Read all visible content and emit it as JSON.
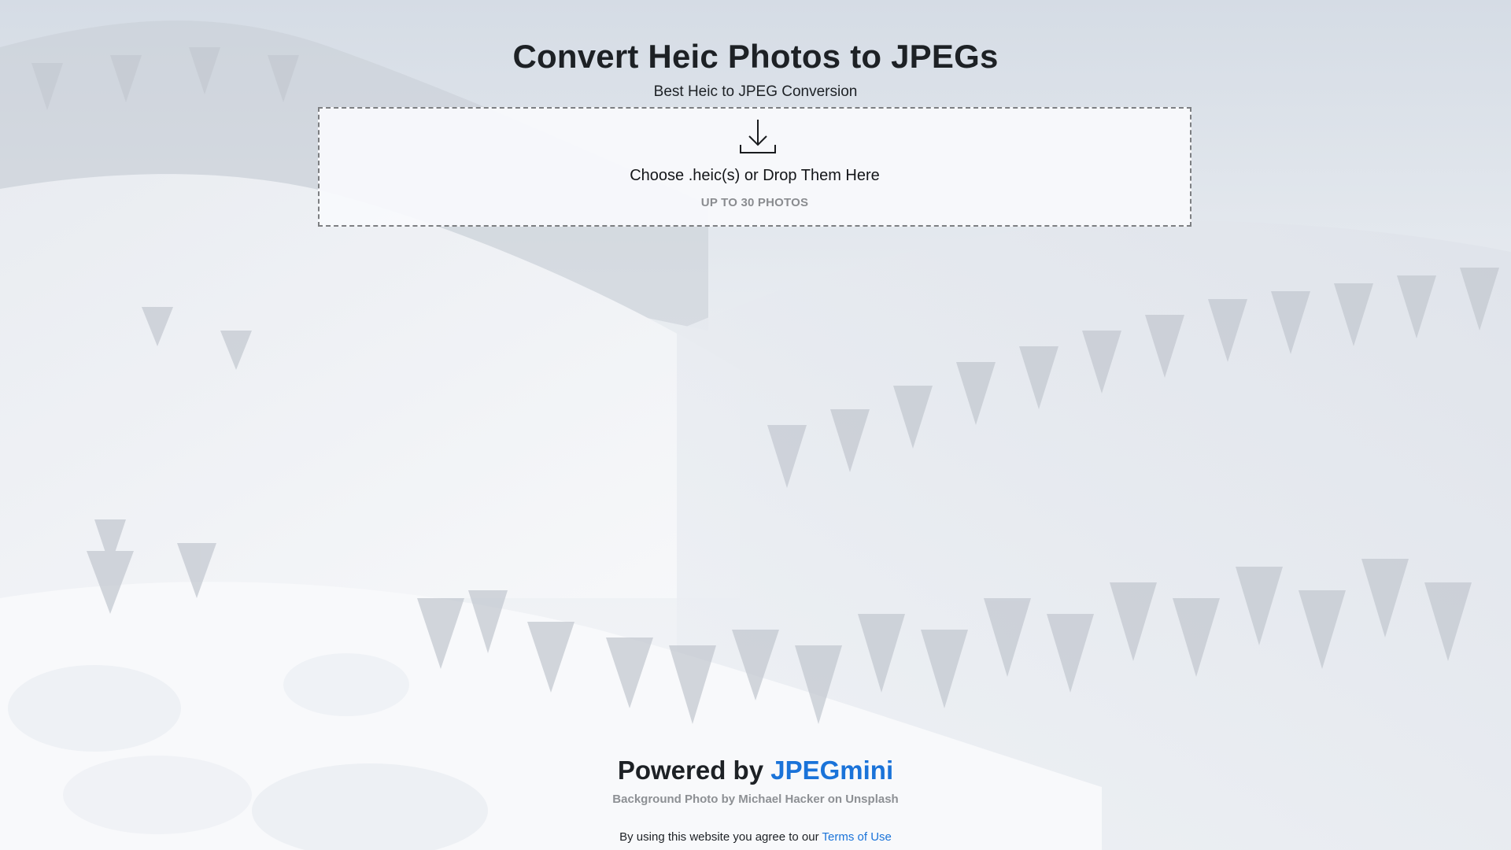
{
  "header": {
    "title": "Convert Heic Photos to JPEGs",
    "subtitle": "Best Heic to JPEG Conversion"
  },
  "dropzone": {
    "icon": "download-icon",
    "label": "Choose .heic(s) or Drop Them Here",
    "hint": "UP TO 30 PHOTOS"
  },
  "footer": {
    "powered_prefix": "Powered by",
    "powered_brand": "JPEGmini",
    "photo_credit": "Background Photo by Michael Hacker on Unsplash",
    "terms_prefix": "By using this website you agree to our",
    "terms_link": "Terms of Use"
  },
  "colors": {
    "link": "#1a73d9",
    "text": "#1d2125",
    "muted": "#8d9094"
  }
}
